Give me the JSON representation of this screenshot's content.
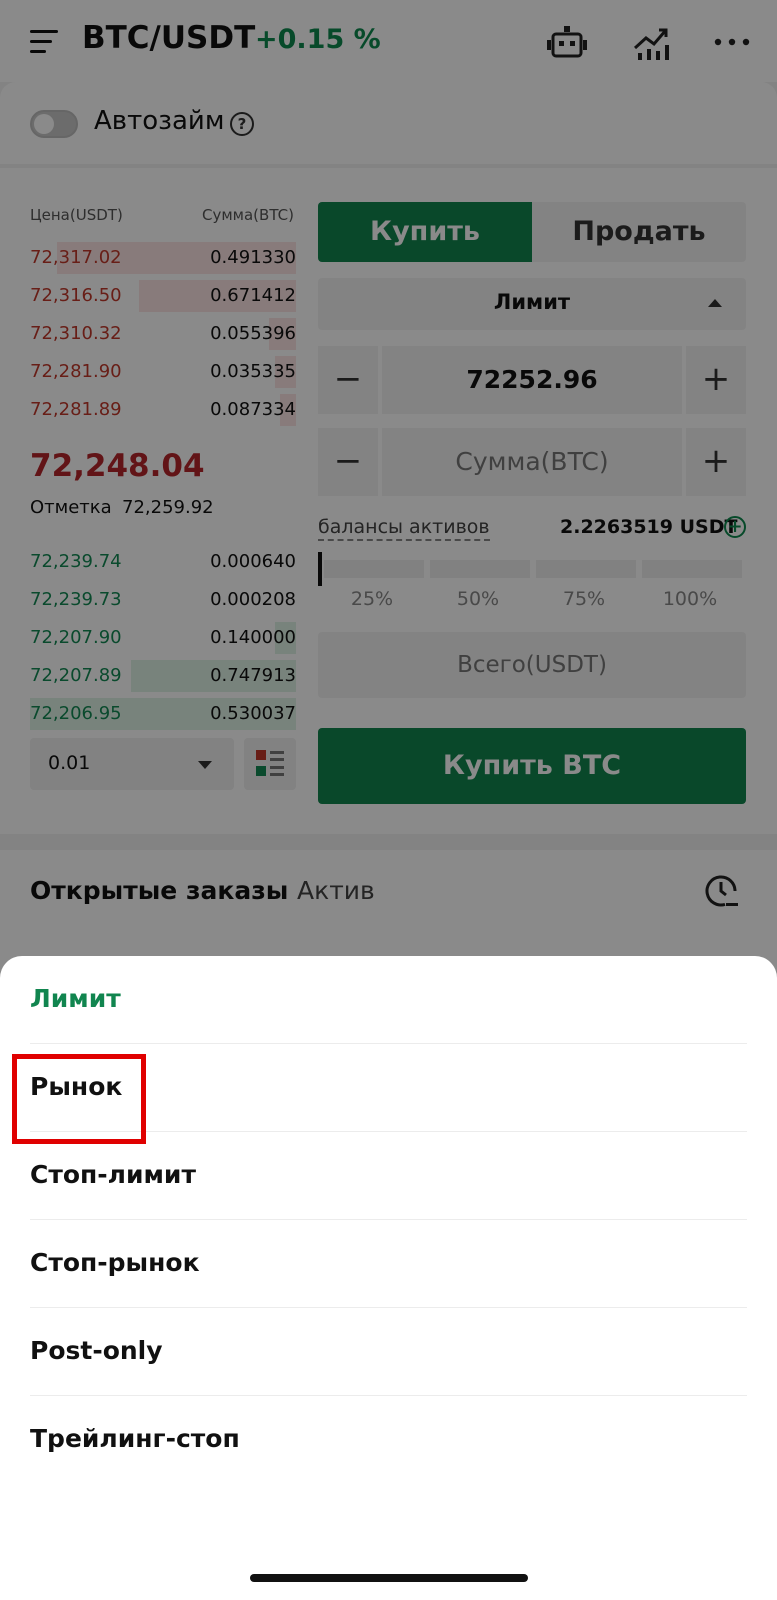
{
  "header": {
    "pair": "BTC/USDT",
    "change": "+0.15 %",
    "icons": [
      "menu-icon",
      "robot-icon",
      "chart-icon",
      "more-icon"
    ]
  },
  "autoborrow": {
    "label": "Автозайм",
    "help": "?",
    "enabled": false
  },
  "orderbook": {
    "price_header": "Цена(USDT)",
    "amount_header": "Сумма(BTC)",
    "asks": [
      {
        "price": "72,317.02",
        "amount": "0.491330",
        "depth": 0.9
      },
      {
        "price": "72,316.50",
        "amount": "0.671412",
        "depth": 0.59
      },
      {
        "price": "72,310.32",
        "amount": "0.055396",
        "depth": 0.1
      },
      {
        "price": "72,281.90",
        "amount": "0.035335",
        "depth": 0.08
      },
      {
        "price": "72,281.89",
        "amount": "0.087334",
        "depth": 0.06
      }
    ],
    "last_price": "72,248.04",
    "mark_label": "Отметка",
    "mark_value": "72,259.92",
    "bids": [
      {
        "price": "72,239.74",
        "amount": "0.000640",
        "depth": 0.0
      },
      {
        "price": "72,239.73",
        "amount": "0.000208",
        "depth": 0.0
      },
      {
        "price": "72,207.90",
        "amount": "0.140000",
        "depth": 0.08
      },
      {
        "price": "72,207.89",
        "amount": "0.747913",
        "depth": 0.62
      },
      {
        "price": "72,206.95",
        "amount": "0.530037",
        "depth": 1.0
      }
    ],
    "depth_value": "0.01"
  },
  "form": {
    "buy_tab": "Купить",
    "sell_tab": "Продать",
    "order_type": "Лимит",
    "minus": "−",
    "plus": "+",
    "price_value": "72252.96",
    "amount_placeholder": "Сумма(BTC)",
    "balance_label": "балансы активов",
    "balance_value": "2.2263519 USDT",
    "add_icon": "+",
    "slider_labels": [
      "25%",
      "50%",
      "75%",
      "100%"
    ],
    "total_placeholder": "Всего(USDT)",
    "submit": "Купить BTC"
  },
  "bottom_tabs": {
    "orders": "Открытые заказы",
    "assets": "Актив"
  },
  "sheet": {
    "items": [
      {
        "label": "Лимит",
        "selected": true
      },
      {
        "label": "Рынок",
        "selected": false
      },
      {
        "label": "Стоп-лимит",
        "selected": false
      },
      {
        "label": "Стоп-рынок",
        "selected": false
      },
      {
        "label": "Post-only",
        "selected": false
      },
      {
        "label": "Трейлинг-стоп",
        "selected": false
      }
    ]
  },
  "colors": {
    "green": "#11854f",
    "red": "#c0392b",
    "highlight": "#e00000"
  }
}
